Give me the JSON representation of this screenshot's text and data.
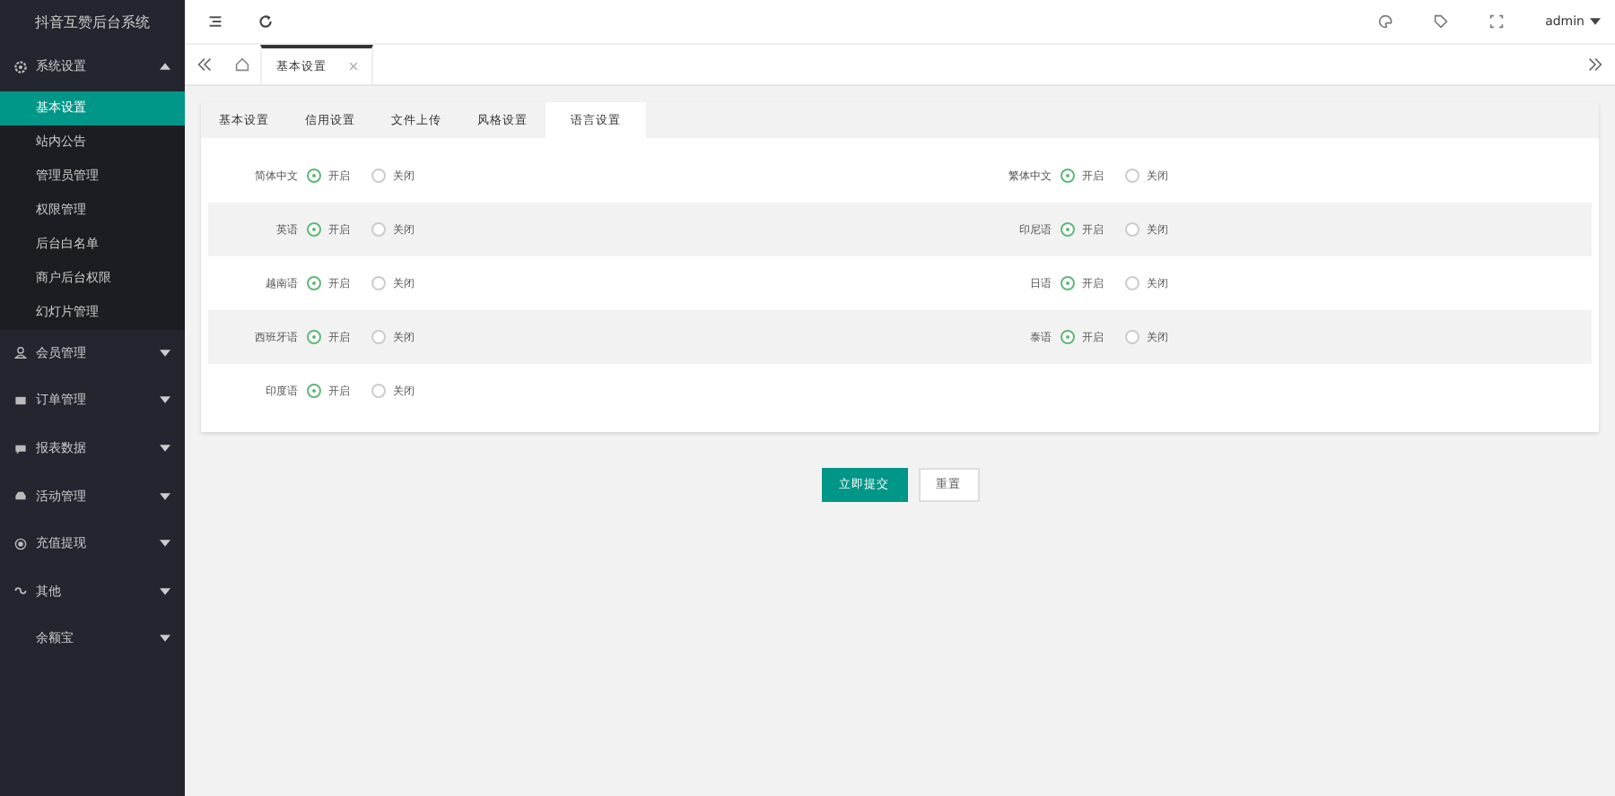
{
  "sidebar": {
    "title": "抖音互赞后台系统",
    "groups": [
      {
        "label": "系统设置",
        "expanded": true,
        "items": [
          {
            "label": "基本设置",
            "selected": true
          },
          {
            "label": "站内公告",
            "selected": false
          },
          {
            "label": "管理员管理",
            "selected": false
          },
          {
            "label": "权限管理",
            "selected": false
          },
          {
            "label": "后台白名单",
            "selected": false
          },
          {
            "label": "商户后台权限",
            "selected": false
          },
          {
            "label": "幻灯片管理",
            "selected": false
          }
        ]
      },
      {
        "label": "会员管理",
        "expanded": false
      },
      {
        "label": "订单管理",
        "expanded": false
      },
      {
        "label": "报表数据",
        "expanded": false
      },
      {
        "label": "活动管理",
        "expanded": false
      },
      {
        "label": "充值提现",
        "expanded": false
      },
      {
        "label": "其他",
        "expanded": false
      },
      {
        "label": "余额宝",
        "expanded": false
      }
    ]
  },
  "header": {
    "user": "admin"
  },
  "page_tabs": [
    {
      "label": "基本设置",
      "selected": true
    }
  ],
  "form_tabs": [
    {
      "label": "基本设置",
      "selected": false
    },
    {
      "label": "信用设置",
      "selected": false
    },
    {
      "label": "文件上传",
      "selected": false
    },
    {
      "label": "风格设置",
      "selected": false
    },
    {
      "label": "语言设置",
      "selected": true
    }
  ],
  "rows": [
    [
      {
        "label": "简体中文",
        "options": [
          {
            "label": "开启",
            "selected": true
          },
          {
            "label": "关闭",
            "selected": false
          }
        ]
      },
      {
        "label": "繁体中文",
        "options": [
          {
            "label": "开启",
            "selected": true
          },
          {
            "label": "关闭",
            "selected": false
          }
        ]
      }
    ],
    [
      {
        "label": "英语",
        "options": [
          {
            "label": "开启",
            "selected": true
          },
          {
            "label": "关闭",
            "selected": false
          }
        ]
      },
      {
        "label": "印尼语",
        "options": [
          {
            "label": "开启",
            "selected": true
          },
          {
            "label": "关闭",
            "selected": false
          }
        ]
      }
    ],
    [
      {
        "label": "越南语",
        "options": [
          {
            "label": "开启",
            "selected": true
          },
          {
            "label": "关闭",
            "selected": false
          }
        ]
      },
      {
        "label": "日语",
        "options": [
          {
            "label": "开启",
            "selected": true
          },
          {
            "label": "关闭",
            "selected": false
          }
        ]
      }
    ],
    [
      {
        "label": "西班牙语",
        "options": [
          {
            "label": "开启",
            "selected": true
          },
          {
            "label": "关闭",
            "selected": false
          }
        ]
      },
      {
        "label": "泰语",
        "options": [
          {
            "label": "开启",
            "selected": true
          },
          {
            "label": "关闭",
            "selected": false
          }
        ]
      }
    ],
    [
      {
        "label": "印度语",
        "options": [
          {
            "label": "开启",
            "selected": true
          },
          {
            "label": "关闭",
            "selected": false
          }
        ]
      }
    ]
  ],
  "buttons": [
    {
      "label": "立即提交",
      "kind": "primary"
    },
    {
      "label": "重置",
      "kind": "plain"
    }
  ]
}
